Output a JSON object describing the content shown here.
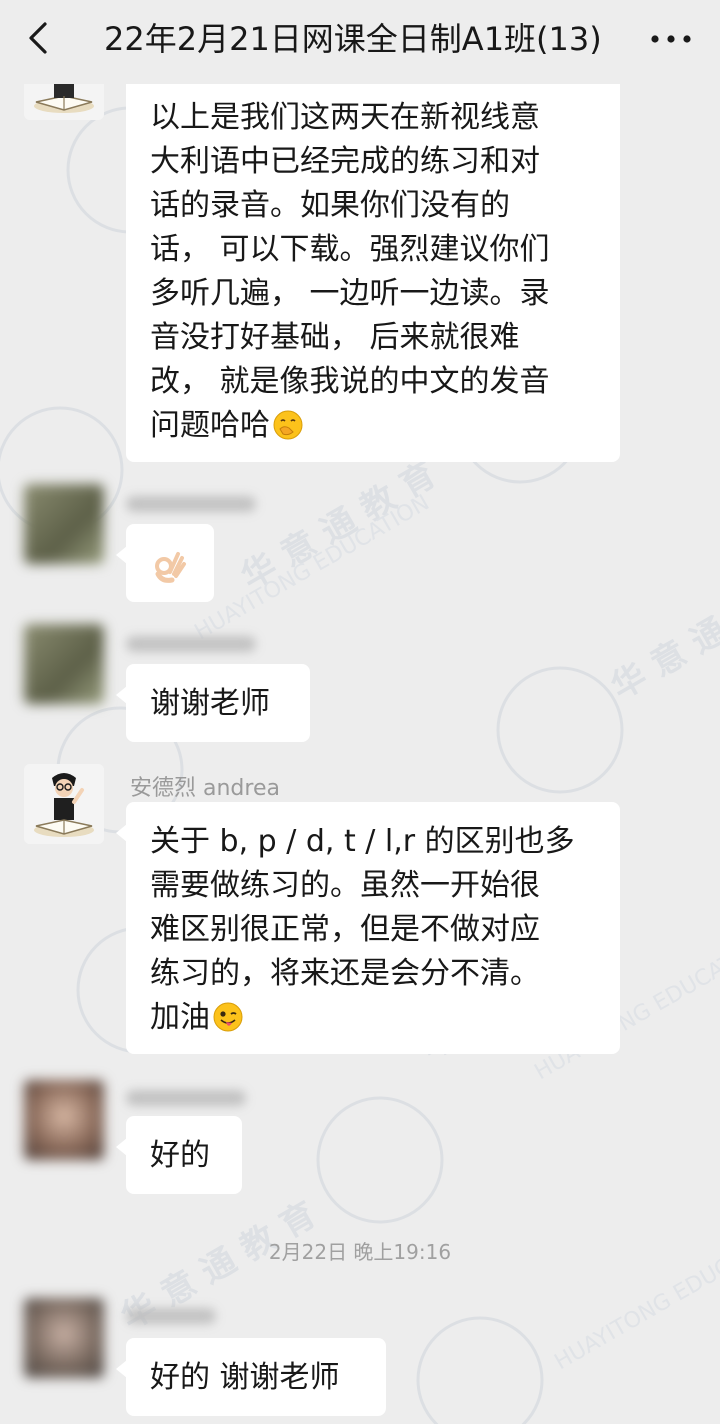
{
  "header": {
    "title": "22年2月21日网课全日制A1班(13)",
    "back_icon": "chevron-left-icon",
    "more_icon": "more-dots-icon"
  },
  "watermark": {
    "cn": "华 意 通 教 育",
    "en": "HUAYITONG EDUCATION"
  },
  "messages": [
    {
      "sender": "",
      "text": "以上是我们这两天在新视线意\n大利语中已经完成的练习和对\n话的录音。如果你们没有的\n话， 可以下载。强烈建议你们\n多听几遍， 一边听一边读。录\n音没打好基础， 后来就很难\n改， 就是像我说的中文的发音\n问题哈哈",
      "emoji": "face-with-hand-over-mouth-icon"
    },
    {
      "sender": "",
      "text": "",
      "emoji": "ok-hand-icon"
    },
    {
      "sender": "",
      "text": "谢谢老师",
      "emoji": ""
    },
    {
      "sender": "安德烈 andrea",
      "text": "关于 b, p / d, t  / l,r 的区别也多\n需要做练习的。虽然一开始很\n难区别很正常，但是不做对应\n练习的，将来还是会分不清。\n加油",
      "emoji": "winking-face-tongue-icon"
    },
    {
      "sender": "",
      "text": "好的",
      "emoji": ""
    },
    {
      "sender": "",
      "text": "好的 谢谢老师",
      "emoji": ""
    }
  ],
  "timestamp": "2月22日 晚上19:16",
  "colors": {
    "background": "#ededed",
    "bubble": "#ffffff",
    "text": "#181818",
    "meta_text": "#9a9a9a"
  }
}
